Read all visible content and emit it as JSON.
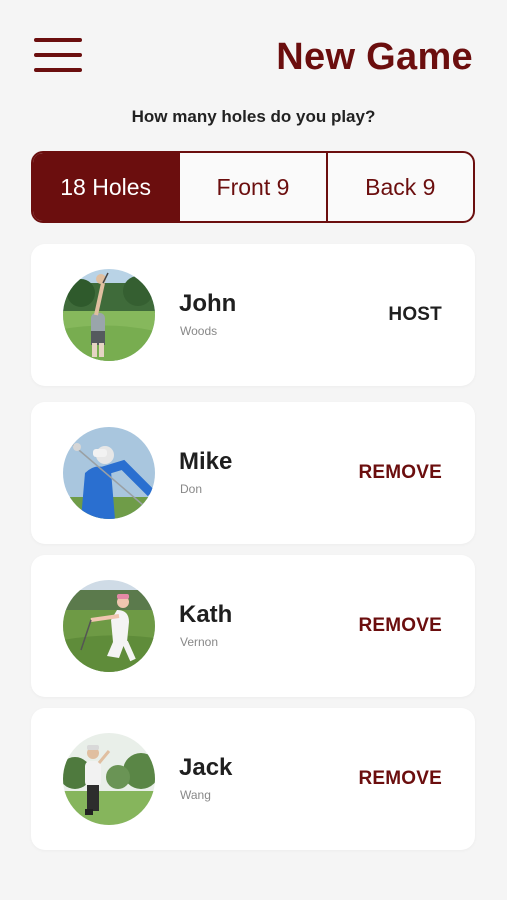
{
  "header": {
    "title": "New Game",
    "menu_icon": "hamburger-menu-icon"
  },
  "question": "How many holes do you play?",
  "hole_options": [
    {
      "label": "18 Holes",
      "selected": true
    },
    {
      "label": "Front 9",
      "selected": false
    },
    {
      "label": "Back 9",
      "selected": false
    }
  ],
  "players": [
    {
      "first_name": "John",
      "last_name": "Woods",
      "action": "HOST"
    },
    {
      "first_name": "Mike",
      "last_name": "Don",
      "action": "REMOVE"
    },
    {
      "first_name": "Kath",
      "last_name": "Vernon",
      "action": "REMOVE"
    },
    {
      "first_name": "Jack",
      "last_name": "Wang",
      "action": "REMOVE"
    }
  ],
  "colors": {
    "accent": "#6b0e0e",
    "background": "#f5f5f5",
    "card": "#ffffff"
  }
}
